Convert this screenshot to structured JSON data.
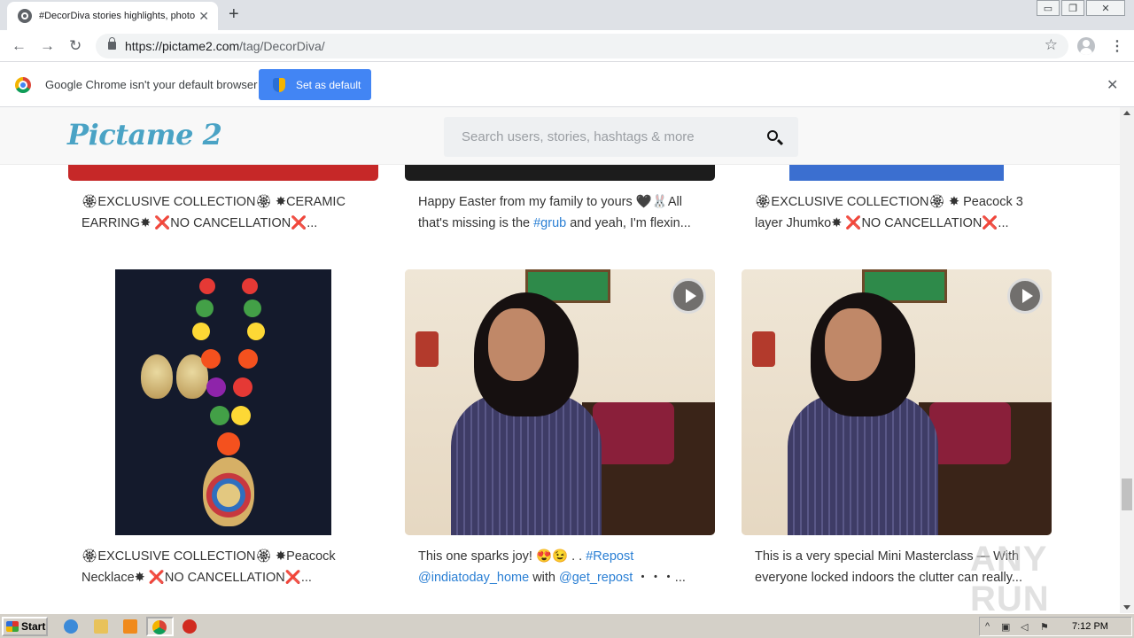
{
  "browser": {
    "tab_title": "#DecorDiva stories highlights, photos",
    "tab_close": "✕",
    "new_tab": "+",
    "url_host": "https://pictame2.com",
    "url_path": "/tag/DecorDiva/",
    "back": "←",
    "forward": "→",
    "reload": "↻",
    "star": "☆",
    "menu": "⋮",
    "win_min": "▭",
    "win_restore": "❐",
    "win_close": "✕"
  },
  "infobar": {
    "message": "Google Chrome isn't your default browser",
    "button_label": "Set as default",
    "close": "✕"
  },
  "site": {
    "logo": "Pictame 2",
    "search_placeholder": "Search users, stories, hashtags & more"
  },
  "posts_row1": [
    {
      "caption": "🏵EXCLUSIVE COLLECTION🏵 ✸CERAMIC EARRING✸ ❌NO CANCELLATION❌..."
    },
    {
      "caption_pre": "Happy Easter from my family to yours 🖤🐰All that's missing is the ",
      "caption_tag": "#grub",
      "caption_post": " and yeah, I'm flexin..."
    },
    {
      "caption": "🏵EXCLUSIVE COLLECTION🏵 ✸ Peacock 3 layer Jhumko✸ ❌NO CANCELLATION❌..."
    }
  ],
  "posts_row2": [
    {
      "caption": "🏵EXCLUSIVE COLLECTION🏵 ✸Peacock Necklace✸ ❌NO CANCELLATION❌..."
    },
    {
      "caption_pre": "This one sparks joy! 😍😉 . . ",
      "tag1": "#Repost",
      "tag2": "@indiatoday_home",
      "caption_mid": " with ",
      "tag3": "@get_repost",
      "caption_post": " ・・・..."
    },
    {
      "caption": "This is a very special Mini Masterclass — With everyone locked indoors the clutter can really..."
    }
  ],
  "watermark": "ANY RUN",
  "taskbar": {
    "start_label": "Start",
    "clock": "7:12 PM"
  },
  "colors": {
    "accent_blue": "#4285f4",
    "logo_color": "#4aa3c5",
    "link_color": "#2a7fd4"
  }
}
